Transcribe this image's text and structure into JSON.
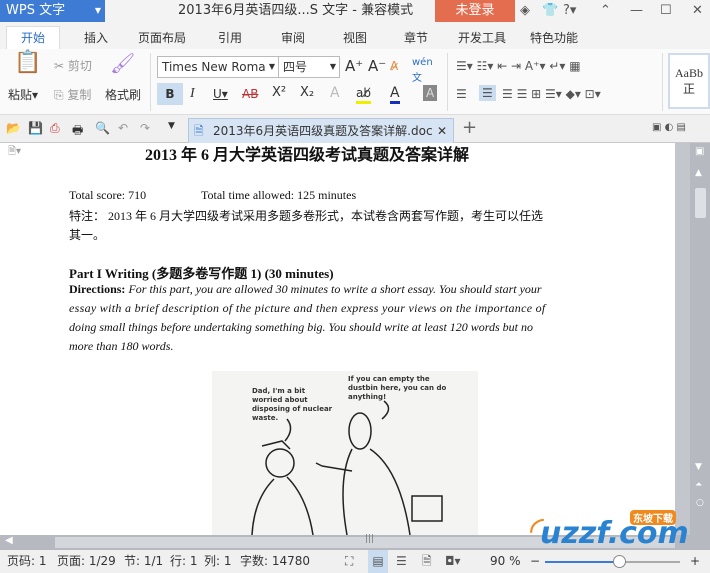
{
  "titlebar": {
    "app": "WPS 文字",
    "title": "2013年6月英语四级...S 文字 - 兼容模式",
    "login": "未登录"
  },
  "tabs": [
    "开始",
    "插入",
    "页面布局",
    "引用",
    "审阅",
    "视图",
    "章节",
    "开发工具",
    "特色功能"
  ],
  "ribbon": {
    "paste": "粘贴",
    "cut": "剪切",
    "copy": "复制",
    "format_painter": "格式刷",
    "font_name": "Times New Roma",
    "font_size": "四号",
    "bold": "B",
    "italic": "I",
    "underline": "U",
    "strike": "AB",
    "superscript": "X²",
    "subscript": "X₂",
    "style_sample": "AaBb",
    "style_name": "正"
  },
  "doc_tab": {
    "name": "2013年6月英语四级真题及答案详解.doc"
  },
  "document": {
    "title": "2013 年  6 月大学英语四级考试真题及答案详解",
    "score": "Total score: 710",
    "time": "Total time allowed: 125 minutes",
    "note1": "特注： 2013 年  6 月大学四级考试采用多题多卷形式，本试卷含两套写作题，考生可以任选",
    "note2": "其一。",
    "part": "Part I Writing    (多题多卷写作题  1) (30 minutes)",
    "dir_label": "Directions:",
    "dir1": "For this part, you are allowed 30 minutes to write a short essay. You should start your",
    "dir2": "essay with a brief description of the picture and then express your views on the importance of",
    "dir3": "doing small things before undertaking something big. You should write at least 120 words but no",
    "dir4": "more than 180 words.",
    "bubble1": "Dad, I'm a bit worried about disposing of nuclear waste.",
    "bubble2": "If you can empty the dustbin here, you can do anything!"
  },
  "status": {
    "page_no": "页码: 1",
    "pages": "页面: 1/29",
    "section": "节: 1/1",
    "row": "行: 1",
    "col": "列: 1",
    "words": "字数: 14780",
    "zoom": "90 %",
    "zoom_fraction": 0.55
  },
  "watermark": {
    "text": "uzzf.com",
    "sub": "东坡下载"
  }
}
